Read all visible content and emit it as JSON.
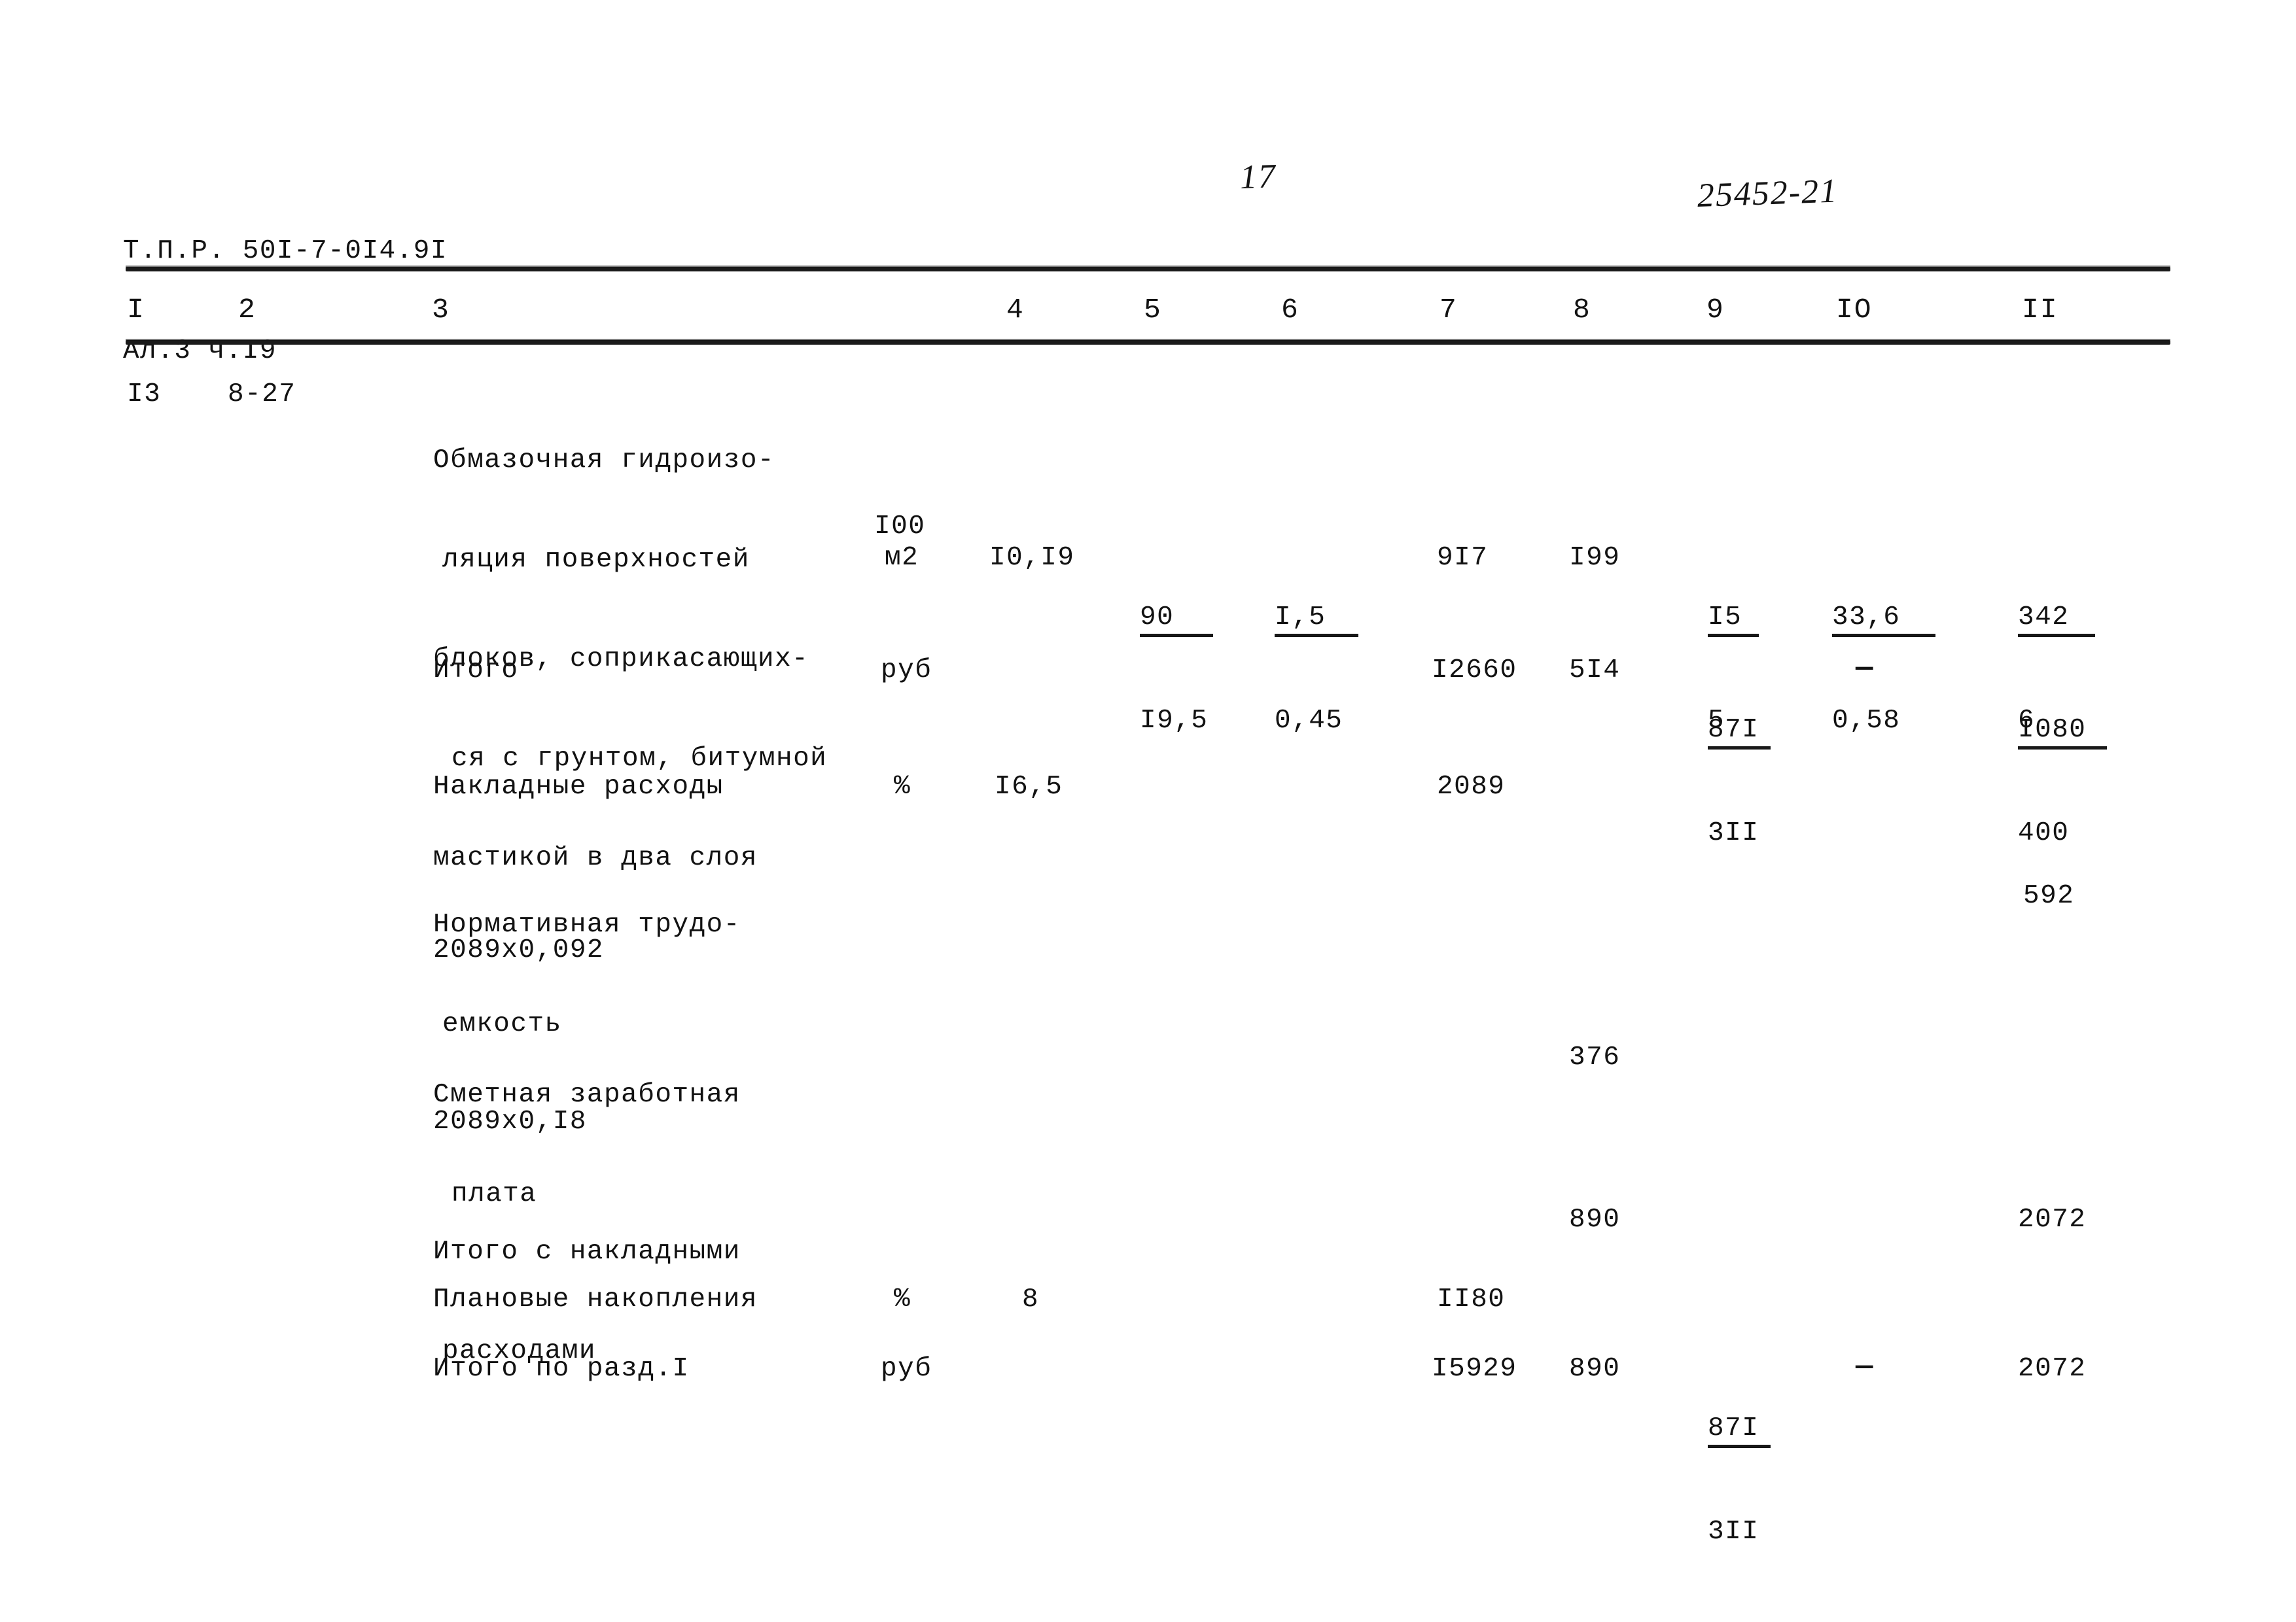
{
  "document": {
    "header": {
      "series_line1": "Т.П.Р. 50I-7-0I4.9I",
      "series_line2": "Ал.3 ч.I9",
      "page_number": "17",
      "archive_code": "25452-21"
    },
    "column_headers": [
      "I",
      "2",
      "3",
      "4",
      "5",
      "6",
      "7",
      "8",
      "9",
      "IO",
      "II"
    ],
    "rows": [
      {
        "num": "I3",
        "code": "8-27",
        "description_lines": [
          "Обмазочная гидроизо-",
          "ляция поверхностей",
          "блоков, соприкасающих-",
          "ся с грунтом, битумной",
          "мастикой в два слоя"
        ],
        "unit_line1": "I00",
        "unit_line2": "м2",
        "col4": "I0,I9",
        "col5_num": "90",
        "col5_den": "I9,5",
        "col6_num": "I,5",
        "col6_den": "0,45",
        "col7": "9I7",
        "col8": "I99",
        "col9_num": "I5",
        "col9_den": "5",
        "col10_num": "33,6",
        "col10_den": "0,58",
        "col11_num": "342",
        "col11_den": "6"
      },
      {
        "label": "Итого",
        "unit": "руб",
        "col7": "I2660",
        "col8": "5I4",
        "col9_num": "87I",
        "col9_den": "3II",
        "col10": "—",
        "col11_num": "I080",
        "col11_den": "400"
      },
      {
        "label": "Накладные расходы",
        "unit": "%",
        "col4": "I6,5",
        "col7": "2089"
      },
      {
        "label_lines": [
          "Нормативная трудо-",
          "емкость"
        ],
        "formula": "2089х0,092",
        "col11": "592"
      },
      {
        "label_lines": [
          "Сметная заработная",
          "плата"
        ],
        "formula": "2089х0,I8",
        "col8": "376"
      },
      {
        "label_lines": [
          "Итого с накладными",
          "расходами"
        ],
        "col8": "890",
        "col11": "2072"
      },
      {
        "label": "Плановые накопления",
        "unit": "%",
        "col4": "8",
        "col7": "II80"
      },
      {
        "label": "Итого по разд.I",
        "unit": "руб",
        "col7": "I5929",
        "col8": "890",
        "col9_num": "87I",
        "col9_den": "3II",
        "col10": "—",
        "col11": "2072"
      }
    ]
  }
}
